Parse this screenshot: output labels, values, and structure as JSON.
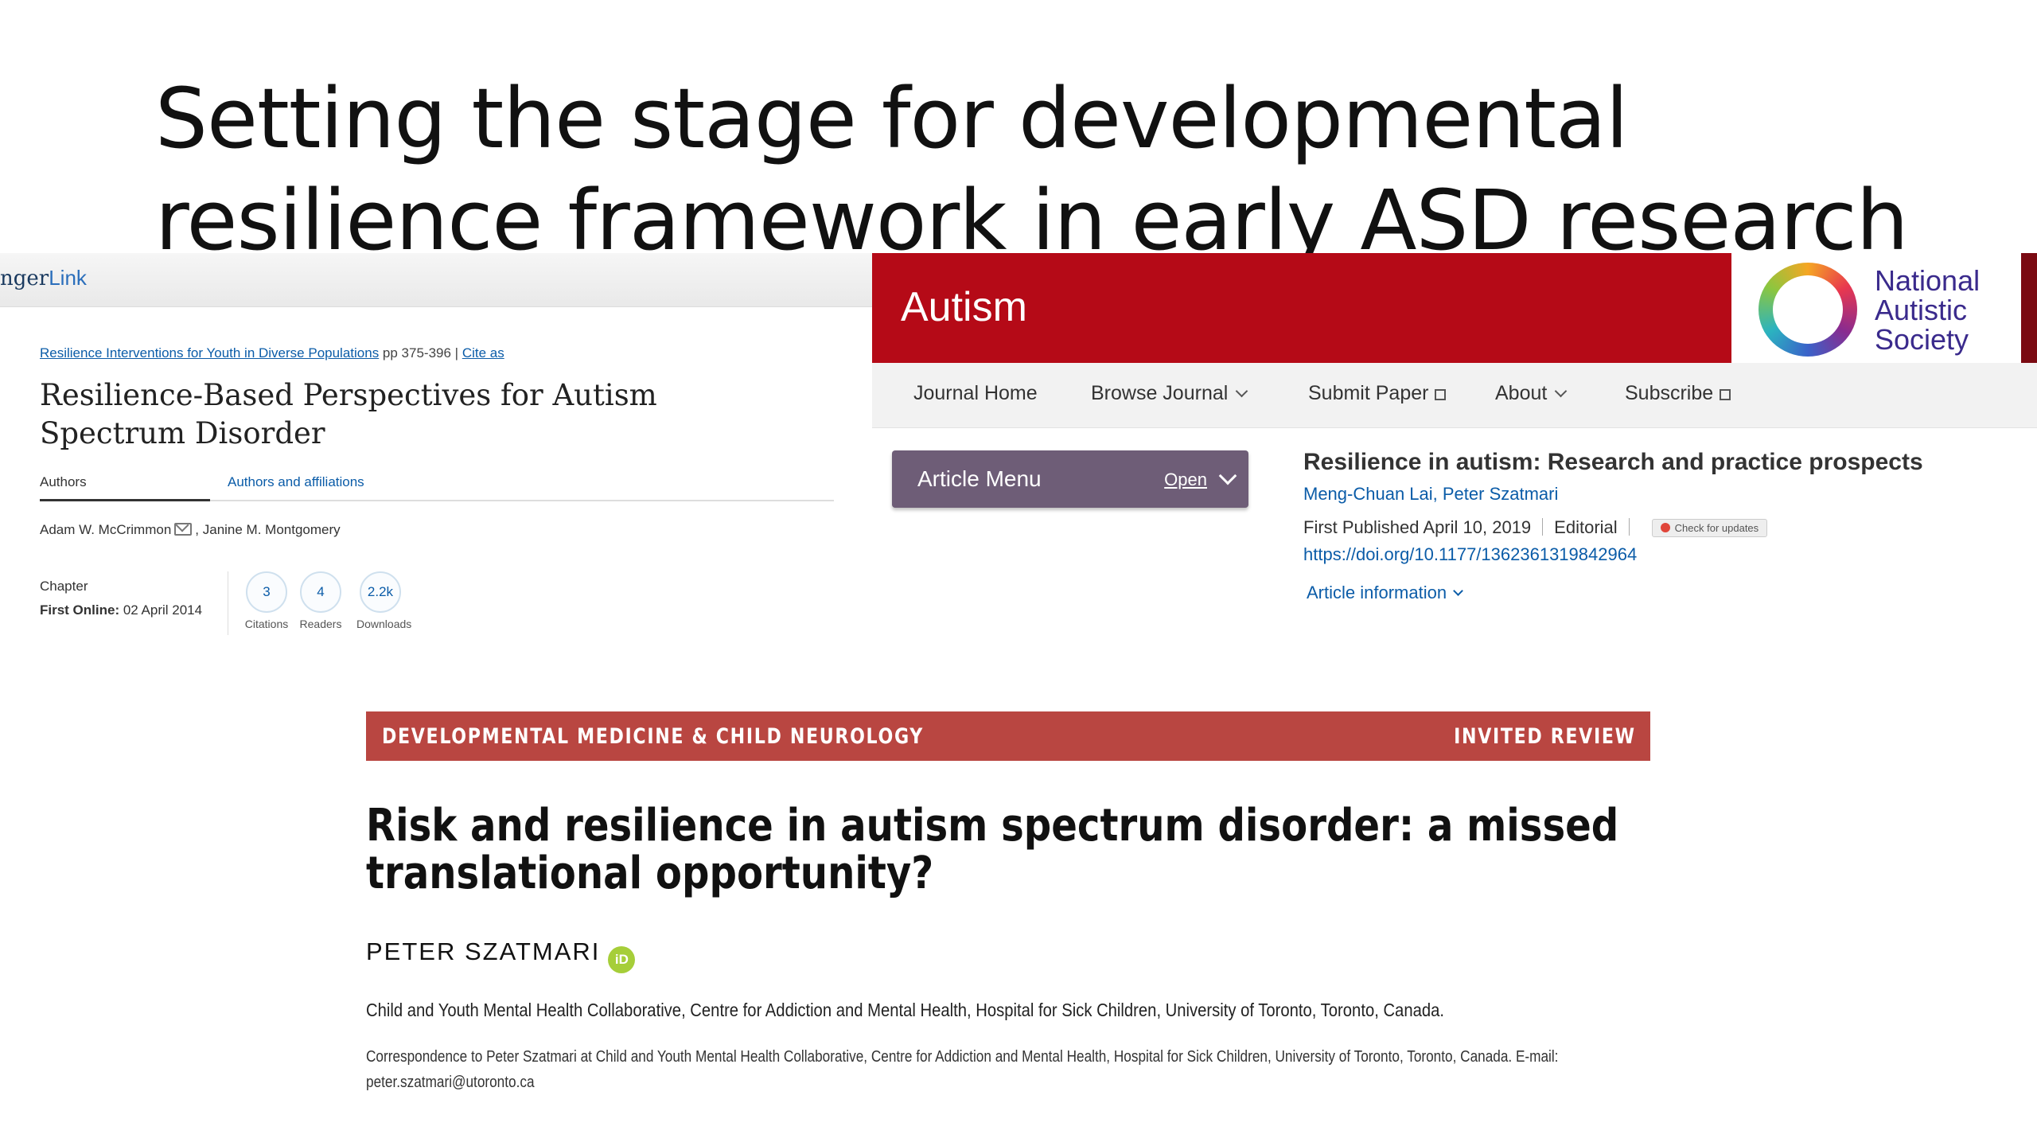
{
  "slide": {
    "title": "Setting the stage for developmental resilience framework in early ASD research"
  },
  "springer": {
    "logo_part1": "nger",
    "logo_part2": "Link",
    "book_link": "Resilience Interventions for Youth in Diverse Populations",
    "pages": " pp 375-396 | ",
    "cite_as": "Cite as",
    "title": "Resilience-Based Perspectives for Autism Spectrum Disorder",
    "tabs": [
      "Authors",
      "Authors and affiliations"
    ],
    "author1": "Adam W. McCrimmon",
    "author2": ", Janine M. Montgomery",
    "chapter_label": "Chapter",
    "first_online_label": "First Online:",
    "first_online_date": " 02 April 2014",
    "metrics": [
      {
        "value": "3",
        "label": "Citations"
      },
      {
        "value": "4",
        "label": "Readers"
      },
      {
        "value": "2.2k",
        "label": "Downloads"
      }
    ]
  },
  "autism": {
    "journal_name": "Autism",
    "logo_text": [
      "National",
      "Autistic",
      "Society"
    ],
    "nav": {
      "journal_home": "Journal Home",
      "browse_journal": "Browse Journal",
      "submit_paper": "Submit Paper",
      "about": "About",
      "subscribe": "Subscribe"
    },
    "article_menu_label": "Article Menu",
    "article_menu_open": "Open",
    "article_title": "Resilience in autism: Research and practice prospects",
    "authors": "Meng-Chuan Lai, Peter Szatmari",
    "first_published": "First Published April 10, 2019",
    "article_type": "Editorial",
    "updates_badge": "Check for updates",
    "doi": "https://doi.org/10.1177/1362361319842964",
    "article_information": "Article information"
  },
  "dmcn": {
    "journal": "DEVELOPMENTAL MEDICINE & CHILD NEUROLOGY",
    "section": "INVITED REVIEW",
    "title": "Risk and resilience in autism spectrum disorder: a missed translational opportunity?",
    "author": "PETER SZATMARI",
    "orcid_label": "iD",
    "affiliation": "Child and Youth Mental Health Collaborative, Centre for Addiction and Mental Health, Hospital for Sick Children, University of Toronto, Toronto, Canada.",
    "correspondence": "Correspondence to Peter Szatmari at Child and Youth Mental Health Collaborative, Centre for Addiction and Mental Health, Hospital for Sick Children, University of Toronto, Toronto, Canada. E-mail: peter.szatmari@utoronto.ca"
  },
  "colors": {
    "autism_red": "#b50a17",
    "dmcn_red": "#b94641",
    "menu_purple": "#6e5d77",
    "link_blue": "#0b5ca8",
    "orcid_green": "#a6ce39"
  }
}
